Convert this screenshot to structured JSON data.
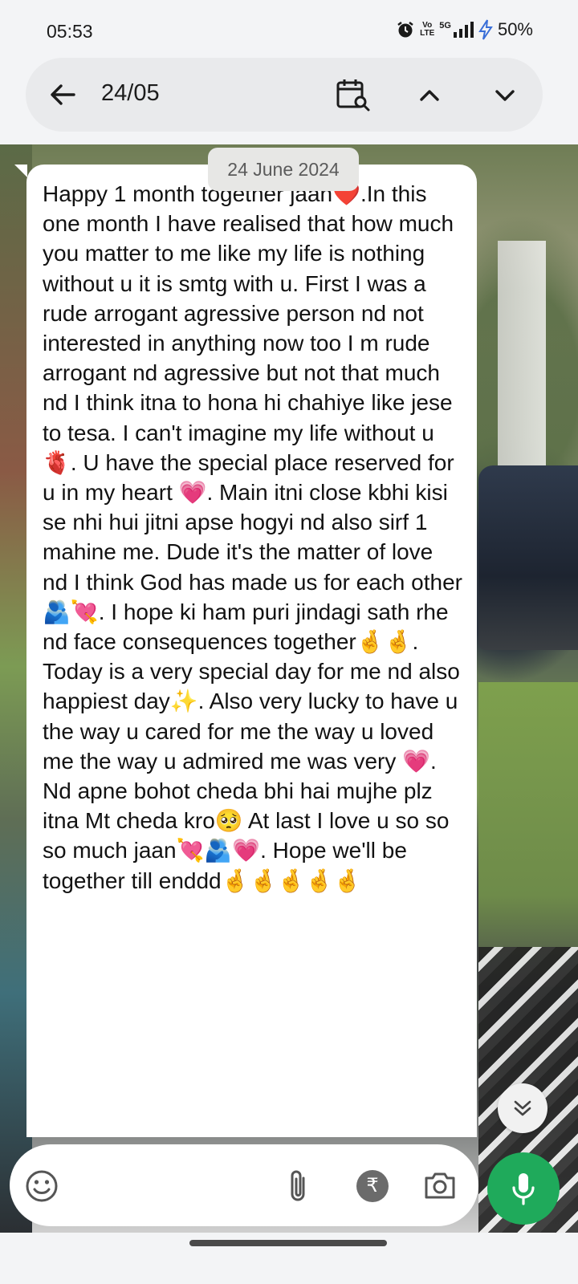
{
  "status_bar": {
    "time": "05:53",
    "network_label_top": "Vo",
    "network_label_bottom": "LTE",
    "network_type": "5G",
    "battery": "50%",
    "icons": [
      "alarm-icon",
      "volte-icon",
      "signal-icon",
      "charging-icon"
    ]
  },
  "search_header": {
    "query": "24/05",
    "icons": [
      "back-arrow-icon",
      "calendar-search-icon",
      "chevron-up-icon",
      "chevron-down-icon"
    ]
  },
  "chat": {
    "date_chip": "24 June 2024",
    "message_text": "Happy 1 month together jaan❤️.In this one month I have realised that how much you matter to me like my life is nothing without u it is smtg with u. First I was a rude arrogant agressive person nd not interested in anything now too I m rude arrogant nd agressive but not that much nd I think itna to hona hi chahiye like jese to tesa. I can't imagine my life without u🫀. U have the special place reserved for u in my heart 💗. Main itni close kbhi kisi se nhi hui jitni apse hogyi nd also sirf 1 mahine me. Dude it's the matter of love nd I think God has made us for each other 🫂💘. I hope ki ham puri jindagi sath rhe nd face consequences together🤞🤞. Today is a very special day for me nd also happiest day✨. Also very lucky to have u the way u cared for me the way u loved me the way u admired me was very 💗. Nd apne bohot cheda bhi hai mujhe plz itna Mt cheda kro🥺 At last I love u so so so much jaan💘🫂💗. Hope we'll be together till enddd🤞🤞🤞🤞🤞"
  },
  "compose": {
    "rupee_symbol": "₹",
    "icons": [
      "emoji-icon",
      "attach-icon",
      "rupee-icon",
      "camera-icon",
      "mic-icon",
      "double-chevron-down-icon"
    ]
  },
  "colors": {
    "mic_button": "#1faa5b",
    "bubble": "#ffffff",
    "header_bg": "#e9eaec"
  }
}
